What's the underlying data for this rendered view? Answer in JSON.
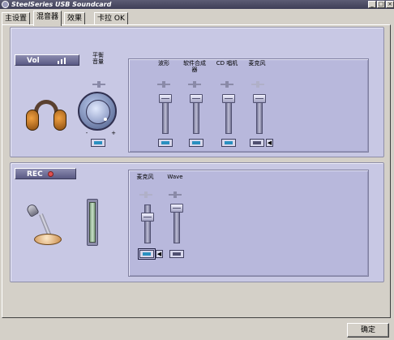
{
  "window": {
    "title": "SteelSeries USB Soundcard",
    "minimize_glyph": "_",
    "maximize_glyph": "□",
    "close_glyph": "×"
  },
  "tabs": [
    {
      "label": "主设置",
      "active": false
    },
    {
      "label": "混音器",
      "active": true
    },
    {
      "label": "效果",
      "active": false
    },
    {
      "label": "卡拉 OK",
      "active": false
    }
  ],
  "playback": {
    "badge_label": "Vol",
    "badge_icon": "volume-bars-icon",
    "balance_label": "平衡\n音量",
    "knob_minus": "-",
    "knob_plus": "+",
    "channels": [
      {
        "label": "波形",
        "level": 0.92,
        "muted": false
      },
      {
        "label": "软件合成\n器",
        "level": 0.92,
        "muted": false
      },
      {
        "label": "CD 唱机",
        "level": 0.92,
        "muted": false
      },
      {
        "label": "麦克风",
        "level": 0.92,
        "muted": true,
        "disabled": true
      }
    ]
  },
  "recording": {
    "badge_label": "REC",
    "badge_icon": "record-dot-icon",
    "channels": [
      {
        "label": "麦克风",
        "level": 0.75,
        "selected": true
      },
      {
        "label": "Wave",
        "level": 0.92,
        "selected": false
      }
    ]
  },
  "footer": {
    "ok_label": "确定"
  },
  "colors": {
    "panel": "#c8c8e4",
    "inner_panel": "#b8b8dc",
    "badge": "#5a5a84",
    "mute_active": "#2a90c0",
    "rec_dot": "#e05050"
  }
}
